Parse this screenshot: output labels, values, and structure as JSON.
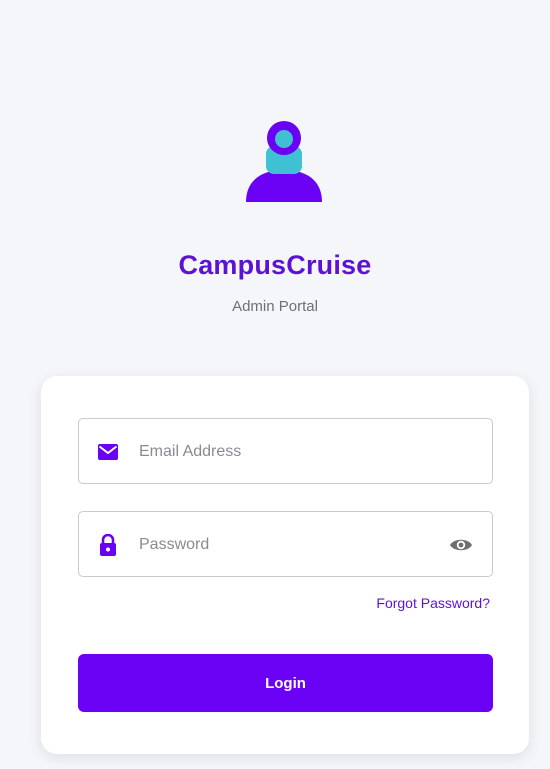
{
  "brand": {
    "logo_icon": "user-avatar-icon",
    "title": "CampusCruise",
    "subtitle": "Admin Portal",
    "colors": {
      "primary": "#6a00f4",
      "title": "#5b12d6",
      "accent": "#3fc1d3"
    }
  },
  "login_form": {
    "email": {
      "icon": "envelope-icon",
      "placeholder": "Email Address",
      "value": ""
    },
    "password": {
      "icon": "lock-icon",
      "placeholder": "Password",
      "value": "",
      "toggle_icon": "eye-icon"
    },
    "forgot_password_label": "Forgot Password?",
    "login_label": "Login"
  }
}
